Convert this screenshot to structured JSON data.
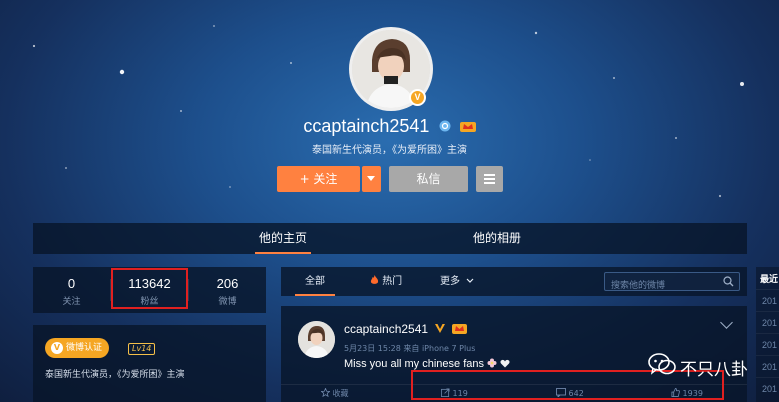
{
  "profile": {
    "username": "ccaptainch2541",
    "bio": "泰国新生代演员，《为爱所困》主演",
    "verified_badge": "V",
    "follow_label": "+ 关注",
    "message_label": "私信"
  },
  "tabs": [
    {
      "label": "他的主页",
      "active": true
    },
    {
      "label": "他的相册",
      "active": false
    }
  ],
  "stats": [
    {
      "value": "0",
      "label": "关注"
    },
    {
      "value": "113642",
      "label": "粉丝"
    },
    {
      "value": "206",
      "label": "微博"
    }
  ],
  "info_card": {
    "badge_label": "微博认证",
    "level": "Lv14",
    "description": "泰国新生代演员，《为爱所困》主演"
  },
  "feed_filter": {
    "tabs": [
      {
        "label": "全部",
        "active": true
      },
      {
        "label": "热门",
        "active": false
      },
      {
        "label": "更多",
        "active": false
      }
    ],
    "search_placeholder": "搜索他的微博"
  },
  "post": {
    "username": "ccaptainch2541",
    "meta": "5月23日 15:28 来自 iPhone 7 Plus",
    "text": "Miss you all my chinese fans",
    "actions": {
      "favorite": "收藏",
      "repost": "119",
      "comment": "642",
      "like": "1939"
    }
  },
  "right_rail": {
    "heading": "最近",
    "items": [
      "201",
      "201",
      "201",
      "201",
      "201"
    ]
  },
  "watermark": {
    "text": "不只八卦"
  },
  "colors": {
    "accent": "#ff8140",
    "highlight_box": "#e02020",
    "verified": "#f5a623"
  },
  "icons": [
    "verified-v-icon",
    "weibo-member-icon",
    "fire-icon",
    "search-icon",
    "chevron-down-icon",
    "star-icon",
    "repost-icon",
    "comment-icon",
    "thumbs-up-icon",
    "wechat-icon"
  ]
}
